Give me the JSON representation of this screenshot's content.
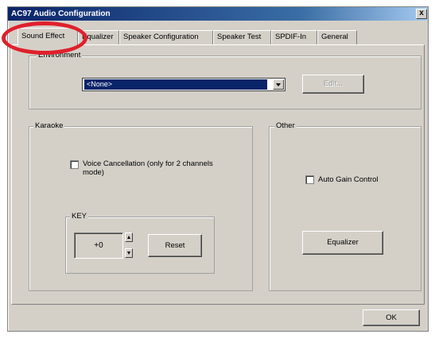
{
  "window": {
    "title": "AC97 Audio Configuration",
    "close_glyph": "x"
  },
  "tabs": [
    {
      "label": "Sound Effect",
      "active": true
    },
    {
      "label": "Equalizer"
    },
    {
      "label": "Speaker Configuration"
    },
    {
      "label": "Speaker Test"
    },
    {
      "label": "SPDIF-In"
    },
    {
      "label": "General"
    }
  ],
  "environment": {
    "group_label": "Environment",
    "selected_value": "<None>",
    "edit_button": "Edit..."
  },
  "karaoke": {
    "group_label": "Karaoke",
    "voice_cancellation_label": "Voice Cancellation (only for 2 channels mode)",
    "key_group_label": "KEY",
    "key_value": "+0",
    "reset_button": "Reset"
  },
  "other": {
    "group_label": "Other",
    "auto_gain_label": "Auto Gain Control",
    "equalizer_button": "Equalizer"
  },
  "footer": {
    "ok_button": "OK"
  },
  "colors": {
    "highlight": "#e0202c",
    "titlebar": "#0a246a",
    "face": "#d4d0c8"
  }
}
